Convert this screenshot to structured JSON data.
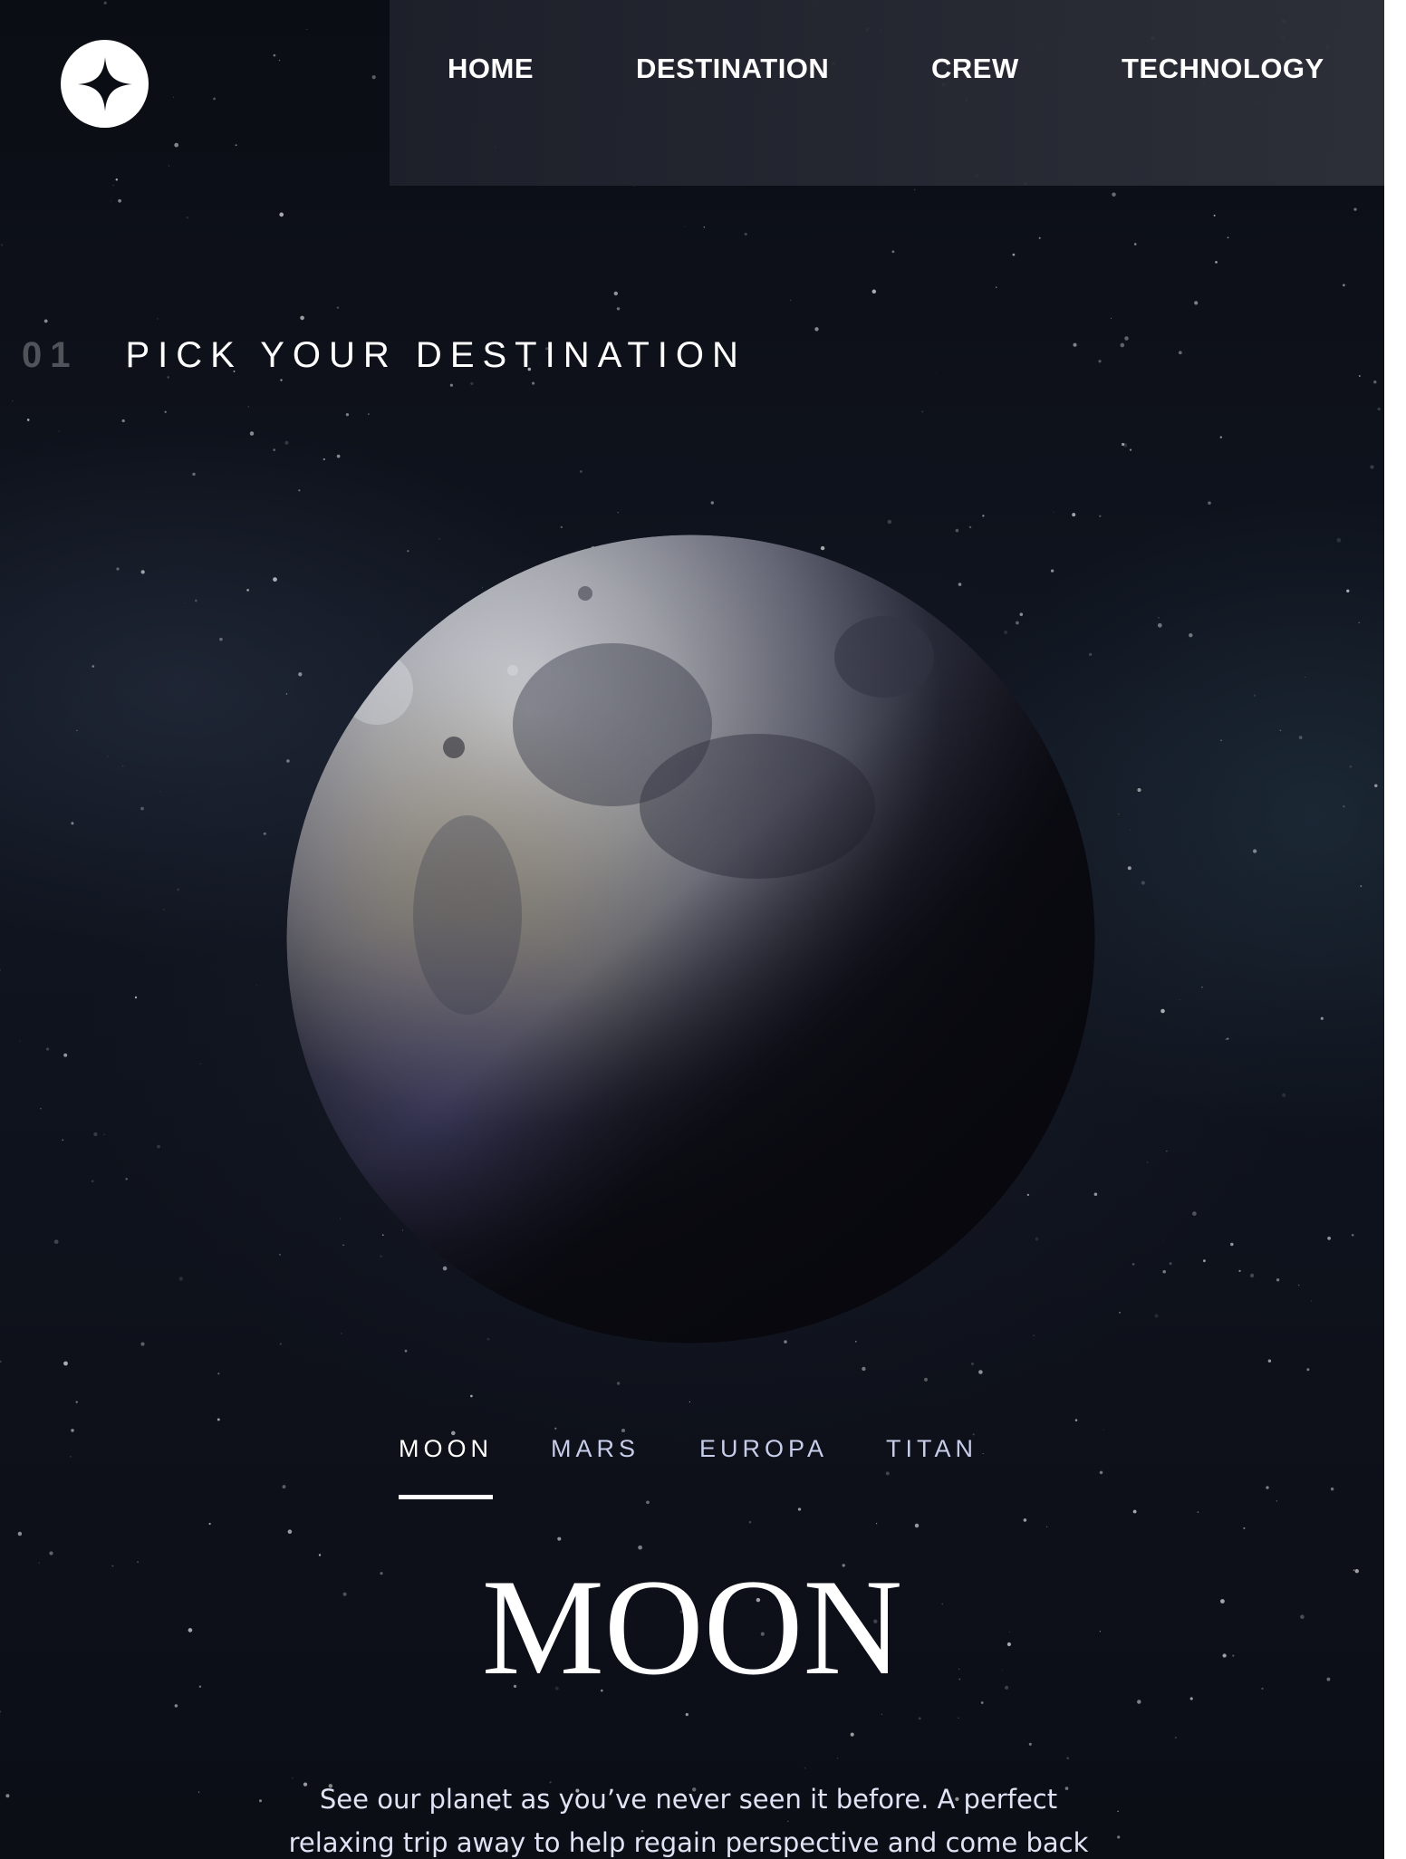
{
  "nav": {
    "links": [
      "HOME",
      "DESTINATION",
      "CREW",
      "TECHNOLOGY"
    ]
  },
  "page": {
    "number": "01",
    "title": "PICK YOUR DESTINATION"
  },
  "tabs": [
    "MOON",
    "MARS",
    "EUROPA",
    "TITAN"
  ],
  "active_tab": "MOON",
  "destination": {
    "name": "MOON",
    "description": "See our planet as you’ve never seen it before. A perfect relaxing trip away to help regain perspective and come back refreshed."
  },
  "icons": {
    "logo": "four-point-star-icon"
  },
  "colors": {
    "background": "#0b0d14",
    "text": "#ffffff",
    "tab_inactive": "#c7cde8",
    "nav_background": "#262933"
  }
}
